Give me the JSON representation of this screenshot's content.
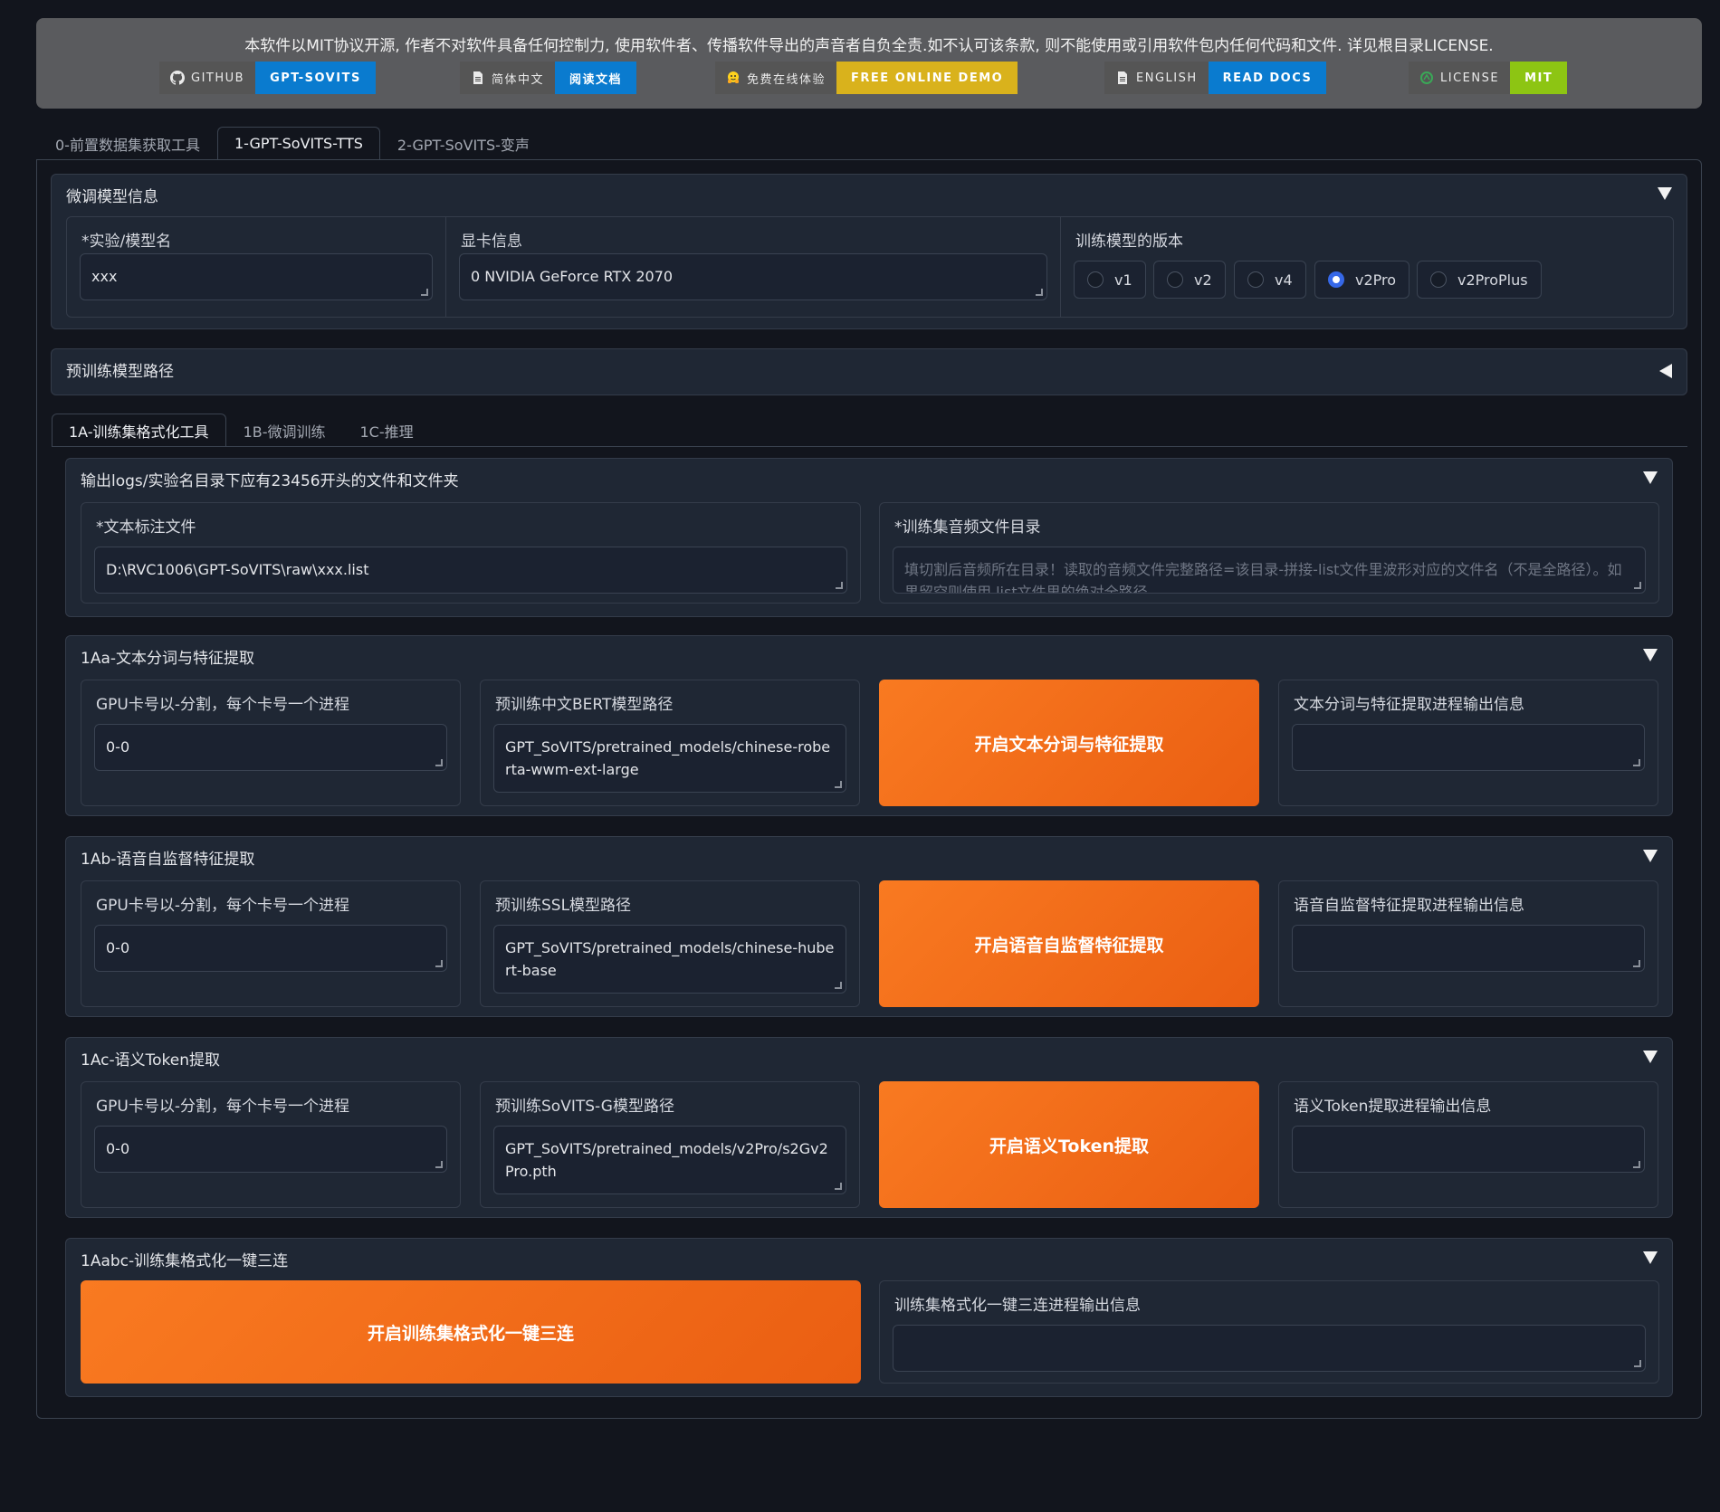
{
  "banner": {
    "notice": "本软件以MIT协议开源, 作者不对软件具备任何控制力, 使用软件者、传播软件导出的声音者自负全责.如不认可该条款, 则不能使用或引用软件包内任何代码和文件. 详见根目录LICENSE.",
    "badges": [
      {
        "left": "GITHUB",
        "right": "GPT-SOVITS",
        "icon": "github-icon",
        "color": "#0a7bcf"
      },
      {
        "left": "简体中文",
        "right": "阅读文档",
        "icon": "document-icon",
        "color": "#0a7bcf"
      },
      {
        "left": "免费在线体验",
        "right": "FREE ONLINE DEMO",
        "icon": "hugging-face-icon",
        "color": "#d9b21c"
      },
      {
        "left": "ENGLISH",
        "right": "READ DOCS",
        "icon": "document-icon",
        "color": "#0a7bcf"
      },
      {
        "left": "LICENSE",
        "right": "MIT",
        "icon": "license-icon",
        "color": "#8dc513"
      }
    ]
  },
  "top_tabs": [
    "0-前置数据集获取工具",
    "1-GPT-SoVITS-TTS",
    "2-GPT-SoVITS-变声"
  ],
  "model_info": {
    "title": "微调模型信息",
    "exp_label": "*实验/模型名",
    "exp_value": "xxx",
    "gpu_label": "显卡信息",
    "gpu_value": "0  NVIDIA GeForce RTX 2070",
    "version_label": "训练模型的版本",
    "versions": [
      "v1",
      "v2",
      "v4",
      "v2Pro",
      "v2ProPlus"
    ],
    "selected_version": "v2Pro"
  },
  "pretrained": {
    "title": "预训练模型路径"
  },
  "sub_tabs": [
    "1A-训练集格式化工具",
    "1B-微调训练",
    "1C-推理"
  ],
  "output_logs": {
    "title": "输出logs/实验名目录下应有23456开头的文件和文件夹",
    "text_label": "*文本标注文件",
    "text_value": "D:\\RVC1006\\GPT-SoVITS\\raw\\xxx.list",
    "audio_label": "*训练集音频文件目录",
    "audio_placeholder": "填切割后音频所在目录！读取的音频文件完整路径=该目录-拼接-list文件里波形对应的文件名（不是全路径）。如果留空则使用.list文件里的绝对全路径。"
  },
  "step_1aa": {
    "title": "1Aa-文本分词与特征提取",
    "gpu_label": "GPU卡号以-分割，每个卡号一个进程",
    "gpu_value": "0-0",
    "model_label": "预训练中文BERT模型路径",
    "model_value": "GPT_SoVITS/pretrained_models/chinese-roberta-wwm-ext-large",
    "button": "开启文本分词与特征提取",
    "output_label": "文本分词与特征提取进程输出信息"
  },
  "step_1ab": {
    "title": "1Ab-语音自监督特征提取",
    "gpu_label": "GPU卡号以-分割，每个卡号一个进程",
    "gpu_value": "0-0",
    "model_label": "预训练SSL模型路径",
    "model_value": "GPT_SoVITS/pretrained_models/chinese-hubert-base",
    "button": "开启语音自监督特征提取",
    "output_label": "语音自监督特征提取进程输出信息"
  },
  "step_1ac": {
    "title": "1Ac-语义Token提取",
    "gpu_label": "GPU卡号以-分割，每个卡号一个进程",
    "gpu_value": "0-0",
    "model_label": "预训练SoVITS-G模型路径",
    "model_value": "GPT_SoVITS/pretrained_models/v2Pro/s2Gv2Pro.pth",
    "button": "开启语义Token提取",
    "output_label": "语义Token提取进程输出信息"
  },
  "step_1aabc": {
    "title": "1Aabc-训练集格式化一键三连",
    "button": "开启训练集格式化一键三连",
    "output_label": "训练集格式化一键三连进程输出信息"
  }
}
